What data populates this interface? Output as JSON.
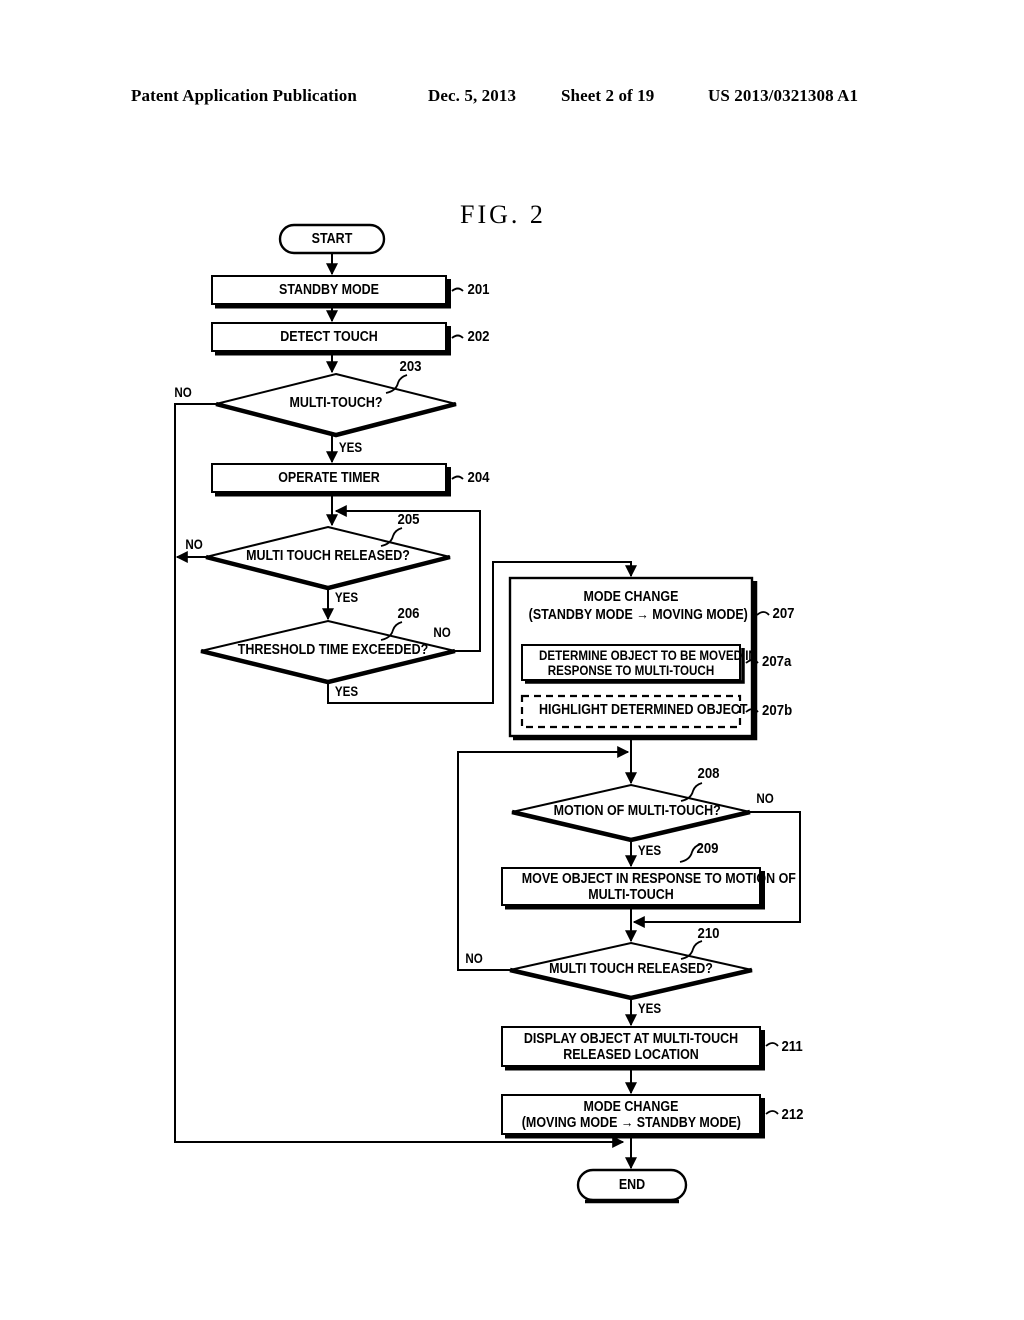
{
  "header": {
    "publication": "Patent Application Publication",
    "date": "Dec. 5, 2013",
    "sheet": "Sheet 2 of 19",
    "number": "US 2013/0321308 A1"
  },
  "figure": {
    "title": "FIG. 2"
  },
  "chart_data": {
    "type": "diagram",
    "title": "FIG. 2",
    "nodes": [
      {
        "id": "start",
        "shape": "terminator",
        "label": "START",
        "ref": ""
      },
      {
        "id": "n201",
        "shape": "process",
        "label": "STANDBY MODE",
        "ref": "201"
      },
      {
        "id": "n202",
        "shape": "process",
        "label": "DETECT TOUCH",
        "ref": "202"
      },
      {
        "id": "n203",
        "shape": "decision",
        "label": "MULTI-TOUCH?",
        "ref": "203"
      },
      {
        "id": "n204",
        "shape": "process",
        "label": "OPERATE TIMER",
        "ref": "204"
      },
      {
        "id": "n205",
        "shape": "decision",
        "label": "MULTI TOUCH RELEASED?",
        "ref": "205"
      },
      {
        "id": "n206",
        "shape": "decision",
        "label": "THRESHOLD TIME EXCEEDED?",
        "ref": "206"
      },
      {
        "id": "n207",
        "shape": "group",
        "label_line1": "MODE CHANGE",
        "label_line2": "(STANDBY MODE → MOVING MODE)",
        "ref": "207"
      },
      {
        "id": "n207a",
        "shape": "process",
        "label_line1": "DETERMINE OBJECT TO BE MOVED IN",
        "label_line2": "RESPONSE TO MULTI-TOUCH",
        "ref": "207a"
      },
      {
        "id": "n207b",
        "shape": "process-dashed",
        "label": "HIGHLIGHT DETERMINED OBJECT",
        "ref": "207b"
      },
      {
        "id": "n208",
        "shape": "decision",
        "label": "MOTION OF MULTI-TOUCH?",
        "ref": "208"
      },
      {
        "id": "n209",
        "shape": "process",
        "label_line1": "MOVE OBJECT IN RESPONSE TO MOTION OF",
        "label_line2": "MULTI-TOUCH",
        "ref": "209"
      },
      {
        "id": "n210",
        "shape": "decision",
        "label": "MULTI TOUCH RELEASED?",
        "ref": "210"
      },
      {
        "id": "n211",
        "shape": "process",
        "label_line1": "DISPLAY OBJECT AT MULTI-TOUCH",
        "label_line2": "RELEASED LOCATION",
        "ref": "211"
      },
      {
        "id": "n212",
        "shape": "process",
        "label_line1": "MODE CHANGE",
        "label_line2": "(MOVING MODE → STANDBY MODE)",
        "ref": "212"
      },
      {
        "id": "end",
        "shape": "terminator",
        "label": "END",
        "ref": ""
      }
    ],
    "edges": [
      {
        "from": "start",
        "to": "n201",
        "label": ""
      },
      {
        "from": "n201",
        "to": "n202",
        "label": ""
      },
      {
        "from": "n202",
        "to": "n203",
        "label": ""
      },
      {
        "from": "n203",
        "to": "exit",
        "label": "NO"
      },
      {
        "from": "n203",
        "to": "n204",
        "label": "YES"
      },
      {
        "from": "n204",
        "to": "n205",
        "label": ""
      },
      {
        "from": "n205",
        "to": "exit",
        "label": "NO"
      },
      {
        "from": "n205",
        "to": "n206",
        "label": "YES"
      },
      {
        "from": "n206",
        "to": "n205",
        "label": "NO"
      },
      {
        "from": "n206",
        "to": "n207",
        "label": "YES"
      },
      {
        "from": "n207",
        "to": "n208",
        "label": ""
      },
      {
        "from": "n208",
        "to": "n210",
        "label": "NO"
      },
      {
        "from": "n208",
        "to": "n209",
        "label": "YES"
      },
      {
        "from": "n209",
        "to": "n210",
        "label": ""
      },
      {
        "from": "n210",
        "to": "n208",
        "label": "NO"
      },
      {
        "from": "n210",
        "to": "n211",
        "label": "YES"
      },
      {
        "from": "n211",
        "to": "n212",
        "label": ""
      },
      {
        "from": "n212",
        "to": "end",
        "label": ""
      }
    ],
    "edge_labels": {
      "no_203": "NO",
      "yes_203": "YES",
      "no_205": "NO",
      "yes_205": "YES",
      "no_206": "NO",
      "yes_206": "YES",
      "no_208": "NO",
      "yes_208": "YES",
      "no_210": "NO",
      "yes_210": "YES"
    },
    "colors": {
      "stroke": "#000000",
      "fill": "#ffffff",
      "background": "#ffffff"
    }
  }
}
